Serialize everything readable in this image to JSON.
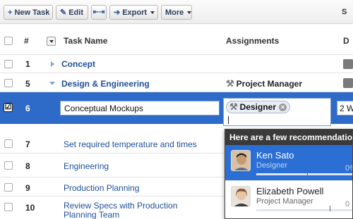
{
  "toolbar": {
    "new_task": {
      "icon": "+",
      "label": "New Task"
    },
    "edit": {
      "icon": "pencil-icon",
      "label": "Edit"
    },
    "indent_icon": "indent-outdent-icon",
    "export": {
      "icon": "arrow-right-icon",
      "label": "Export"
    },
    "more": {
      "label": "More"
    },
    "right_label": "S"
  },
  "header": {
    "num": "#",
    "task_name": "Task Name",
    "assignments": "Assignments",
    "right": "D"
  },
  "rows": [
    {
      "num": "1",
      "name": "Concept",
      "bold": true,
      "expander": "collapsed"
    },
    {
      "num": "5",
      "name": "Design & Engineering",
      "bold": true,
      "expander": "expanded",
      "assignment": "Project Manager"
    },
    {
      "num": "7",
      "name": "Set required temperature and times"
    },
    {
      "num": "8",
      "name": "Engineering"
    },
    {
      "num": "9",
      "name": "Production Planning"
    },
    {
      "num": "10",
      "name": "Review Specs with Production Planning Team"
    }
  ],
  "selected_row": {
    "num": "6",
    "checkbox_mark": "☑",
    "name_value": "Conceptual Mockups",
    "assignment_token": "Designer",
    "duration_value": "2 W"
  },
  "popup": {
    "heading": "Here are a few recommendations",
    "recommendations": [
      {
        "name": "Ken Sato",
        "role": "Designer",
        "workload": 0.0,
        "pct_label": "0%",
        "active": true
      },
      {
        "name": "Elizabeth Powell",
        "role": "Project Manager",
        "workload": 0.0,
        "pct_label": "0",
        "active": false
      }
    ]
  },
  "colors": {
    "selection": "#2e6ac8",
    "link": "#1d4f9b",
    "popup_header": "#3a3a3a",
    "popup_active": "#2c6fd4"
  }
}
